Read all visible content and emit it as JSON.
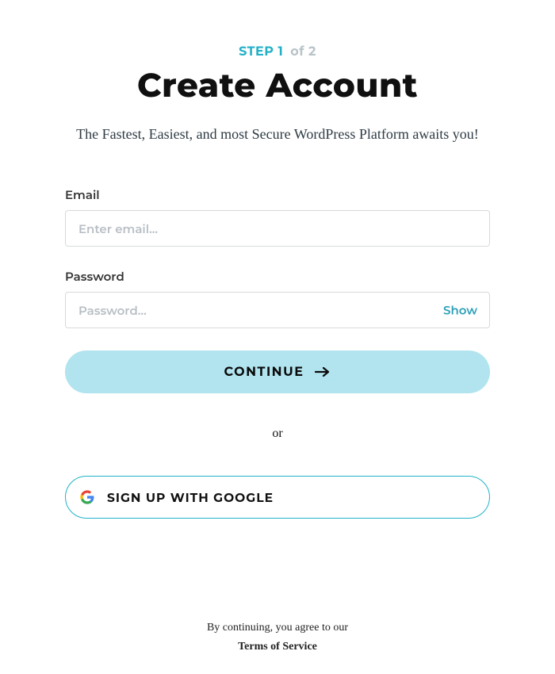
{
  "step": {
    "prefix": "STEP 1",
    "suffix": "of 2"
  },
  "title": "Create Account",
  "subtitle": "The Fastest, Easiest, and most Secure WordPress Platform awaits you!",
  "form": {
    "email": {
      "label": "Email",
      "placeholder": "Enter email...",
      "value": ""
    },
    "password": {
      "label": "Password",
      "placeholder": "Password...",
      "value": "",
      "toggle": "Show"
    },
    "continue_label": "CONTINUE"
  },
  "separator": "or",
  "google_label": "SIGN UP WITH GOOGLE",
  "footer": {
    "line1": "By continuing, you agree to our",
    "tos": "Terms of Service"
  }
}
